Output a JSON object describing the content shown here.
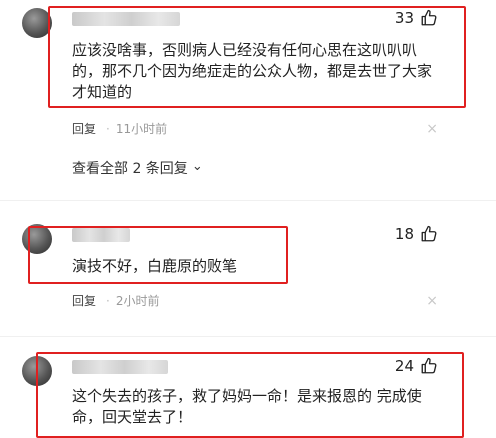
{
  "comments": [
    {
      "likes": "33",
      "text_lines": [
        "应该没啥事，否则病人已经没有任何心思在这叭叭叭",
        "的，那不几个因为绝症走的公众人物，都是去世了大家",
        "才知道的"
      ],
      "reply_label": "回复",
      "time": "11小时前",
      "view_all": "查看全部 2 条回复"
    },
    {
      "likes": "18",
      "text_lines": [
        "演技不好，白鹿原的败笔"
      ],
      "reply_label": "回复",
      "time": "2小时前"
    },
    {
      "likes": "24",
      "text_lines": [
        "这个失去的孩子，救了妈妈一命！是来报恩的 完成使",
        "命，回天堂去了！"
      ]
    }
  ],
  "ui": {
    "separator": "·",
    "close_glyph": "×",
    "chevron_glyph": "⌄"
  },
  "colors": {
    "highlight": "#e02020",
    "meta": "#999999",
    "text": "#222222"
  },
  "icons": [
    "thumbs-up-icon",
    "close-icon",
    "chevron-down-icon",
    "avatar"
  ]
}
